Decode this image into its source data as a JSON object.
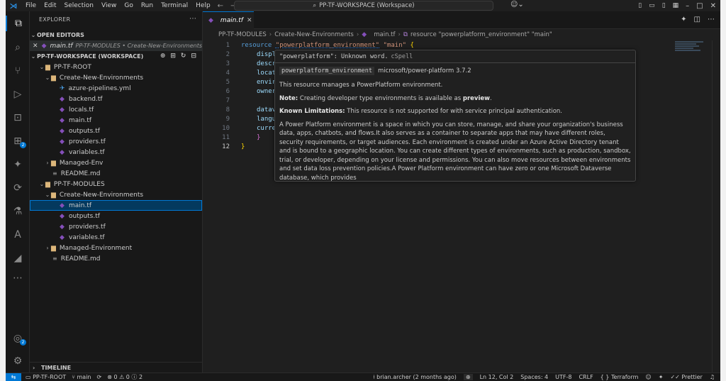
{
  "titlebar": {
    "menu": [
      "File",
      "Edit",
      "Selection",
      "View",
      "Go",
      "Run",
      "Terminal",
      "Help"
    ],
    "command_center": "PP-TF-WORKSPACE (Workspace)"
  },
  "sidebar": {
    "title": "EXPLORER",
    "open_editors_label": "OPEN EDITORS",
    "open_editor": {
      "file": "main.tf",
      "path": "PP-TF-MODULES • Create-New-Environments"
    },
    "workspace_label": "PP-TF-WORKSPACE (WORKSPACE)",
    "root1": {
      "name": "PP-TF-ROOT",
      "folder1": "Create-New-Environments",
      "files1": [
        "azure-pipelines.yml",
        "backend.tf",
        "locals.tf",
        "main.tf",
        "outputs.tf",
        "providers.tf",
        "variables.tf"
      ],
      "folder2": "Managed-Env",
      "readme": "README.md"
    },
    "root2": {
      "name": "PP-TF-MODULES",
      "folder1": "Create-New-Environments",
      "files1": [
        "main.tf",
        "outputs.tf",
        "providers.tf",
        "variables.tf"
      ],
      "folder2": "Managed-Environment",
      "readme": "README.md"
    },
    "timeline_label": "TIMELINE"
  },
  "activity_badges": {
    "extensions": "2",
    "accounts": "2"
  },
  "editor": {
    "tab_label": "main.tf",
    "breadcrumb": [
      "PP-TF-MODULES",
      "Create-New-Environments",
      "main.tf",
      "resource \"powerplatform_environment\" \"main\""
    ],
    "line_numbers": [
      "1",
      "2",
      "3",
      "4",
      "5",
      "6",
      "7",
      "8",
      "9",
      "10",
      "11",
      "12"
    ],
    "code": {
      "l1_kw": "resource",
      "l1_s1": "\"powerplatform_environment\"",
      "l1_s2": "\"main\"",
      "l1_brace": "{",
      "l2": "displ",
      "l3": "descr",
      "l4": "locat",
      "l5": "envir",
      "l6": "owner",
      "l8": "datav",
      "l9": "langu",
      "l10": "curre",
      "l11": "}",
      "l12": "}"
    }
  },
  "hover": {
    "cspell_word": "\"powerplatform\"",
    "cspell_msg": ": Unknown word.",
    "cspell_src": "cSpell",
    "sig_name": "powerplatform_environment",
    "sig_provider": "microsoft/power-platform 3.7.2",
    "summary": "This resource manages a PowerPlatform environment.",
    "note_label": "Note:",
    "note_text": " Creating developer type environments is available as ",
    "note_bold": "preview",
    "note_end": ".",
    "limits_label": "Known Limitations:",
    "limits_text": " This resource is not supported for with service principal authentication.",
    "description": "A Power Platform environment is a space in which you can store, manage, and share your organization's business data, apps, chatbots, and flows.It also serves as a container to separate apps that may have different roles, security requirements, or target audiences. Each environment is created under an Azure Active Directory tenant and is bound to a geographic location. You can create different types of environments, such as production, sandbox, trial, or developer, depending on your license and permissions. You can also move resources between environments and set data loss prevention policies.A Power Platform environment can have zero or one Microsoft Dataverse database, which provides"
  },
  "status": {
    "root": "PP-TF-ROOT",
    "branch": "main",
    "problems": "0 ⚠ 0 ⓘ 2",
    "blame": "brian.archer (2 months ago)",
    "position": "Ln 12, Col 2",
    "spaces": "Spaces: 4",
    "encoding": "UTF-8",
    "eol": "CRLF",
    "language": "Terraform",
    "formatter": "Prettier"
  }
}
